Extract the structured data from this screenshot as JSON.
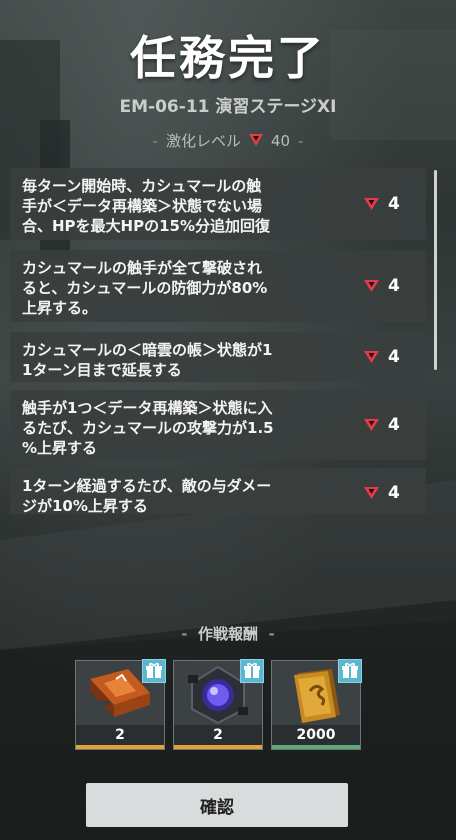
{
  "header": {
    "title": "任務完了",
    "stage": "EM-06-11 演習ステージXI"
  },
  "difficulty": {
    "label": "激化レベル",
    "value": "40",
    "icon": "red-down-triangle-icon"
  },
  "modifiers": [
    {
      "text": "毎ターン開始時、カシュマールの触\n手が＜データ再構築＞状態でない場\n合、HPを最大HPの15%分追加回復",
      "level": "4"
    },
    {
      "text": "カシュマールの触手が全て撃破され\nると、カシュマールの防御力が80%\n上昇する。",
      "level": "4"
    },
    {
      "text": "カシュマールの＜暗雲の帳＞状態が1\n1ターン目まで延長する",
      "level": "4"
    },
    {
      "text": "触手が1つ＜データ再構築＞状態に入\nるたび、カシュマールの攻撃力が1.5\n%上昇する",
      "level": "4"
    },
    {
      "text": "1ターン経過するたび、敵の与ダメー\nジが10%上昇する",
      "level": "4"
    }
  ],
  "rewards": {
    "title": "作戦報酬",
    "items": [
      {
        "name": "orange-data-chip",
        "count": "2",
        "rarity_color": "#e0a33a"
      },
      {
        "name": "purple-core-crystal",
        "count": "2",
        "rarity_color": "#e0a33a"
      },
      {
        "name": "gold-credits",
        "count": "2000",
        "rarity_color": "#5fa87a"
      }
    ]
  },
  "actions": {
    "confirm_label": "確認"
  },
  "colors": {
    "accent_red": "#e23b4b",
    "gift_blue": "#5bb6cf"
  }
}
